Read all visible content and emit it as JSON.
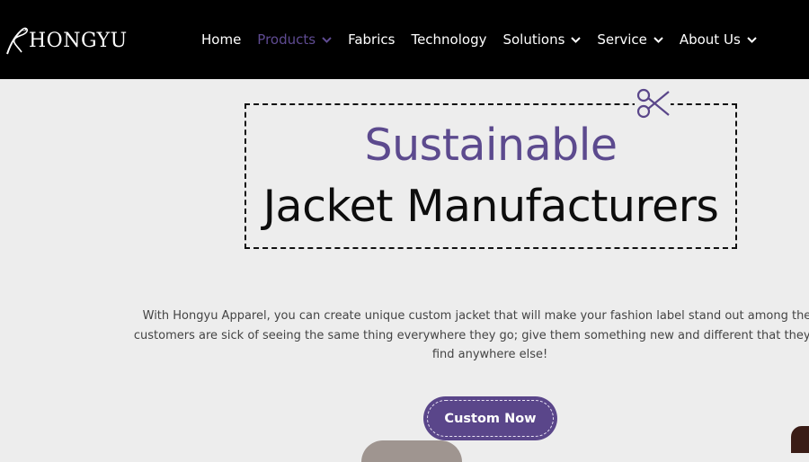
{
  "brand": {
    "name": "HONGYU",
    "icon": "needle-thread-icon"
  },
  "nav": {
    "items": [
      {
        "label": "Home",
        "has_dropdown": false,
        "active": false
      },
      {
        "label": "Products",
        "has_dropdown": true,
        "active": true
      },
      {
        "label": "Fabrics",
        "has_dropdown": false,
        "active": false
      },
      {
        "label": "Technology",
        "has_dropdown": false,
        "active": false
      },
      {
        "label": "Solutions",
        "has_dropdown": true,
        "active": false
      },
      {
        "label": "Service",
        "has_dropdown": true,
        "active": false
      },
      {
        "label": "About Us",
        "has_dropdown": true,
        "active": false
      }
    ]
  },
  "hero": {
    "title_line1": "Sustainable",
    "title_line2": "Jacket Manufacturers",
    "decor_icon": "scissors-icon",
    "intro_lines": [
      "With Hongyu Apparel, you can create unique custom jacket that will make your fashion label stand out among the rest",
      "customers are sick of seeing the same thing everywhere they go; give them something new and different that they won't",
      "find anywhere else!"
    ],
    "cta_label": "Custom Now"
  },
  "colors": {
    "header_bg": "#000000",
    "accent_purple": "#5a468a",
    "page_bg": "#ededed"
  }
}
